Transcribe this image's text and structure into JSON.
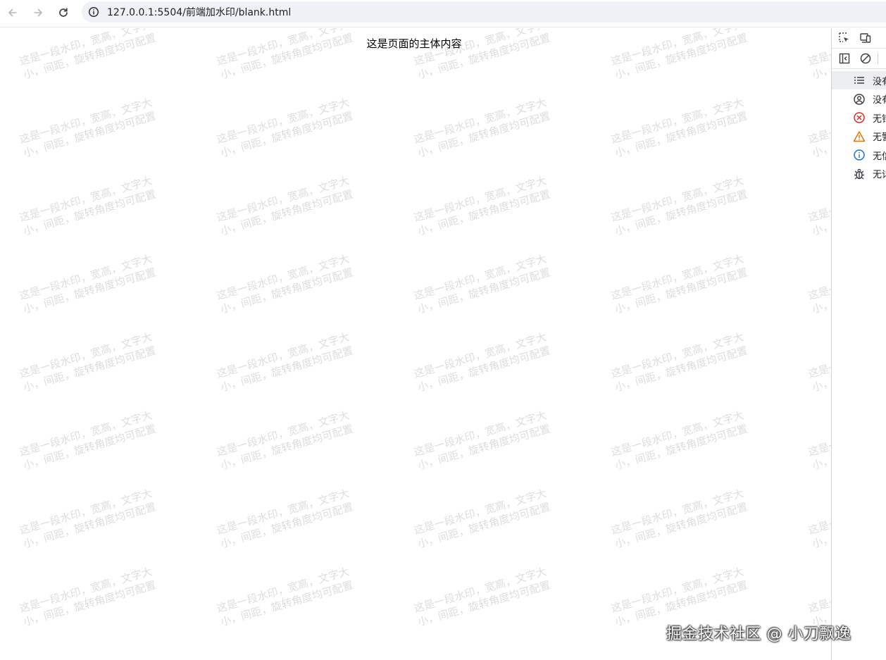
{
  "browser": {
    "url": "127.0.0.1:5504/前端加水印/blank.html",
    "nav": {
      "back": "arrow-left-icon",
      "forward": "arrow-right-icon",
      "reload": "reload-icon",
      "site_info": "info-circle-icon"
    }
  },
  "page": {
    "main_text": "这是页面的主体内容",
    "watermark": {
      "text": "这是一段水印，宽高，文字大小，间距，旋转角度均可配置",
      "color": "#969696",
      "rotation_deg": -16
    }
  },
  "devtools": {
    "toolbar_icons": [
      "inspect-element-icon",
      "device-toolbar-icon"
    ],
    "console_toolbar_icons": [
      "sidebar-toggle-icon",
      "clear-console-icon"
    ],
    "filters": [
      {
        "name": "messages",
        "icon": "list-icon",
        "label": "没有",
        "selected": true
      },
      {
        "name": "user-messages",
        "icon": "user-circle-icon",
        "label": "没有",
        "selected": false
      },
      {
        "name": "errors",
        "icon": "error-icon",
        "label": "无错",
        "selected": false
      },
      {
        "name": "warnings",
        "icon": "warning-icon",
        "label": "无警",
        "selected": false
      },
      {
        "name": "info",
        "icon": "info-icon",
        "label": "无信",
        "selected": false
      },
      {
        "name": "verbose",
        "icon": "bug-icon",
        "label": "无详",
        "selected": false
      }
    ]
  },
  "credit": "掘金技术社区 @ 小刀飘逸"
}
